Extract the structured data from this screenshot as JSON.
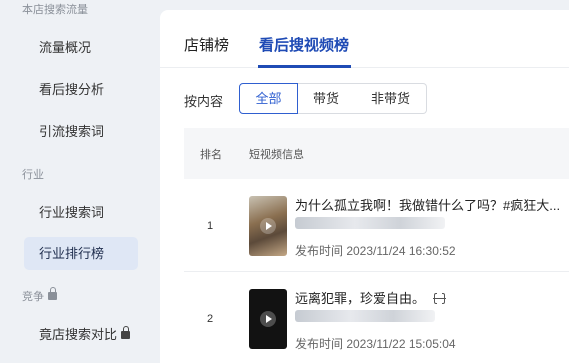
{
  "sidebar": {
    "sections": [
      {
        "label": "本店搜索流量"
      },
      {
        "label": "行业"
      },
      {
        "label": "竞争"
      }
    ],
    "items": [
      {
        "label": "流量概况"
      },
      {
        "label": "看后搜分析"
      },
      {
        "label": "引流搜索词"
      },
      {
        "label": "行业搜索词"
      },
      {
        "label": "行业排行榜"
      },
      {
        "label": "竟店搜索对比"
      }
    ],
    "active_item": "行业排行榜"
  },
  "tabs": [
    {
      "label": "店铺榜"
    },
    {
      "label": "看后搜视频榜"
    }
  ],
  "active_tab": "看后搜视频榜",
  "filter": {
    "label": "按内容",
    "options": [
      {
        "label": "全部"
      },
      {
        "label": "带货"
      },
      {
        "label": "非带货"
      }
    ],
    "selected": "全部"
  },
  "table": {
    "columns": [
      "排名",
      "短视频信息"
    ],
    "rows": [
      {
        "rank": "1",
        "title": "为什么孤立我啊！我做错什么了吗？#疯狂大...",
        "date": "发布时间 2023/11/24 16:30:52"
      },
      {
        "rank": "2",
        "title": "远离犯罪，珍爱自由。",
        "date": "发布时间 2023/11/22 15:05:04"
      }
    ]
  },
  "colors": {
    "accent": "#1f4bb5",
    "sidebar_bg": "#eef1f5",
    "active_item_bg": "#dfe7f5"
  }
}
